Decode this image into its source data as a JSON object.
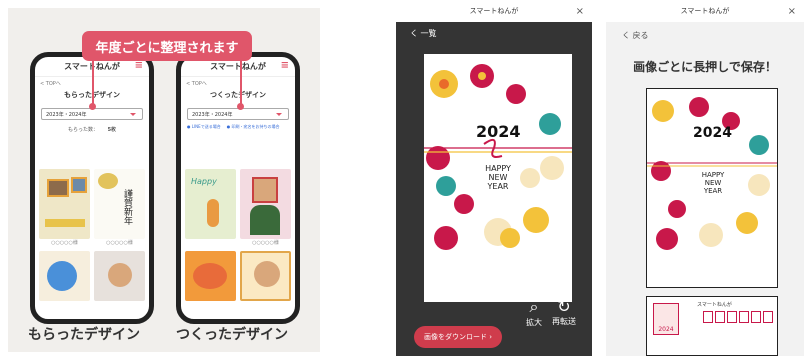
{
  "left": {
    "banner": "年度ごとに整理されます",
    "app_name": "スマートねんが",
    "menu_icon": "hamburger-icon",
    "top_link": "< TOPへ",
    "received": {
      "title": "もらったデザイン",
      "select": "2023年・2024年",
      "count_label": "もらった数：",
      "count_value": "5枚",
      "captions": [
        "○○○○○様",
        "○○○○○様"
      ],
      "footer": "もらったデザイン"
    },
    "made": {
      "title": "つくったデザイン",
      "select": "2023年・2024年",
      "link1": "● LINEで送る場合",
      "link2": "● 印刷・宛名をお持ちの場合",
      "captions": [
        "○○○○○様"
      ],
      "footer": "つくったデザイン"
    }
  },
  "mid": {
    "app_title": "スマートねんが",
    "close": "×",
    "back": "く 一覧",
    "card": {
      "year": "2024",
      "greeting": [
        "HAPPY",
        "NEW",
        "YEAR"
      ]
    },
    "zoom_label": "拡大",
    "zoom_icon": "search-icon",
    "rotate_label": "再転送",
    "rotate_icon": "refresh-icon",
    "download": "画像をダウンロード ›"
  },
  "right": {
    "app_title": "スマートねんが",
    "close": "×",
    "back": "く 戻る",
    "title": "画像ごとに長押しで保存！",
    "card": {
      "year": "2024",
      "greeting": [
        "HAPPY",
        "NEW",
        "YEAR"
      ]
    },
    "postcard_brand": "スマートねんが",
    "stamp_year": "2024"
  },
  "colors": {
    "accent": "#e0566a",
    "dark_bg": "#343434",
    "download_btn": "#cf3c4c"
  }
}
